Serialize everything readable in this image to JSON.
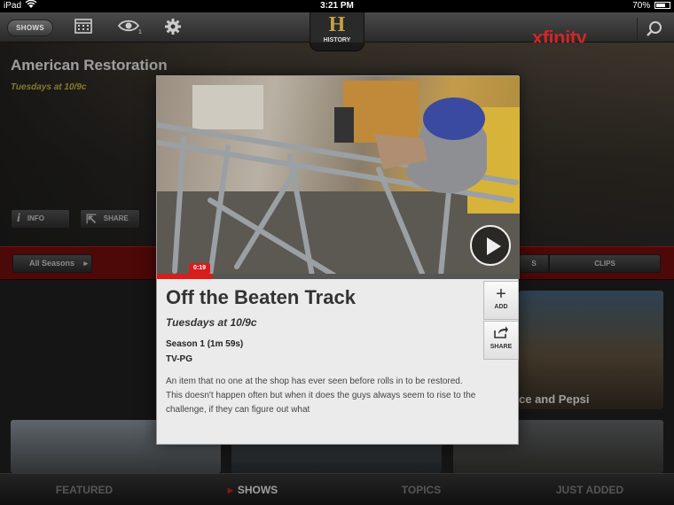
{
  "status_bar": {
    "carrier": "iPad",
    "time": "3:21 PM",
    "battery": "70%",
    "battery_level": 0.7
  },
  "top_bar": {
    "shows_label": "SHOWS",
    "calendar_icon": "calendar-icon",
    "watchlist_icon": "eye-icon",
    "watchlist_count": "1",
    "settings_icon": "gear-icon",
    "network_logo_letter": "H",
    "network_logo_text": "HISTORY",
    "brand": "xfinity",
    "search_icon": "search-icon"
  },
  "show": {
    "title": "American Restoration",
    "airtime": "Tuesdays at 10/9c",
    "info_label": "INFO",
    "share_label": "SHARE"
  },
  "tabs": {
    "seasons_label": "All Seasons",
    "segment_a": "S",
    "segment_b": "CLIPS"
  },
  "episode_tiles": [
    {
      "caption": "ce and Pepsi"
    }
  ],
  "modal": {
    "time_badge": "0:19",
    "progress": 0.155,
    "play_icon": "play-icon",
    "title": "Off the Beaten Track",
    "airtime": "Tuesdays at 10/9c",
    "season": "Season 1 (1m 59s)",
    "rating": "TV-PG",
    "description": "An item that no one at the shop has ever seen before rolls in to be restored. This doesn't happen often but when it does the guys always seem to rise to the challenge, if they can figure out what",
    "add_label": "ADD",
    "share_label": "SHARE"
  },
  "bottom_tabs": [
    {
      "label": "FEATURED",
      "active": false
    },
    {
      "label": "SHOWS",
      "active": true
    },
    {
      "label": "TOPICS",
      "active": false
    },
    {
      "label": "JUST ADDED",
      "active": false
    }
  ],
  "colors": {
    "brand_red": "#d81d1d",
    "tab_strip_red": "#7c0d0d",
    "airtime_yellow": "#d5c64a",
    "logo_gold": "#c8a043"
  }
}
